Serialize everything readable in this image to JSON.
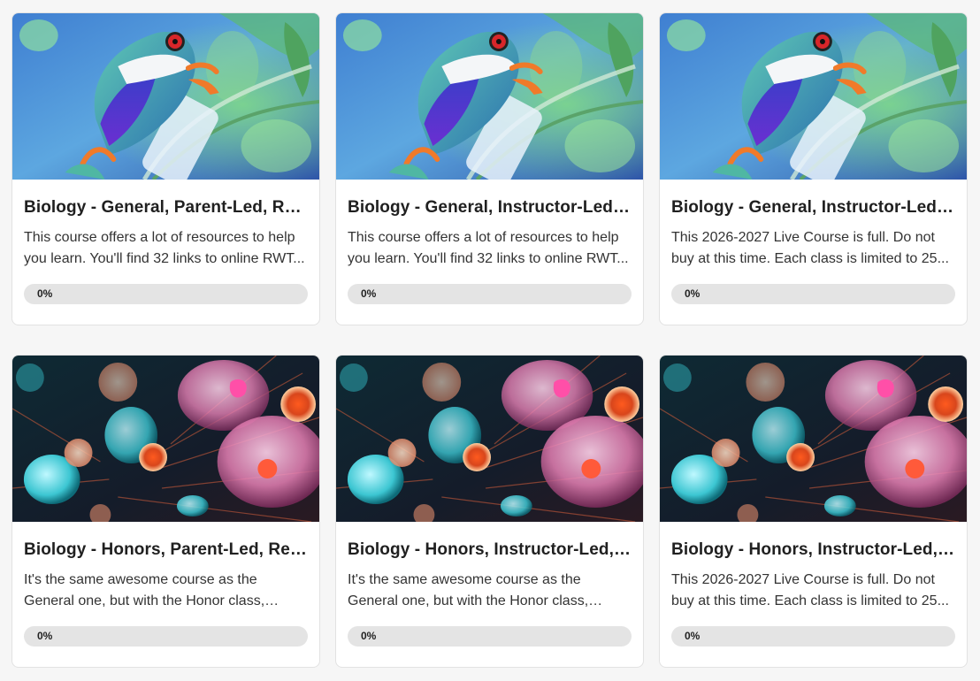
{
  "courses": [
    {
      "title": "Biology - General, Parent-Led, Re...",
      "description": "This course offers a lot of resources to help you learn. You'll find 32 links to online RWT...",
      "progress_label": "0%",
      "progress": 0,
      "image": "frog-image"
    },
    {
      "title": "Biology - General, Instructor-Led, ...",
      "description": "This course offers a lot of resources to help you learn. You'll find 32 links to online RWT...",
      "progress_label": "0%",
      "progress": 0,
      "image": "frog-image"
    },
    {
      "title": "Biology - General, Instructor-Led, ...",
      "description": "This 2026-2027 Live Course is full. Do not buy at this time. Each class is limited to 25...",
      "progress_label": "0%",
      "progress": 0,
      "image": "frog-image"
    },
    {
      "title": "Biology - Honors, Parent-Led, Rec...",
      "description": "It's the same awesome course as the General one, but with the Honor class, students nee...",
      "progress_label": "0%",
      "progress": 0,
      "image": "cells-image"
    },
    {
      "title": "Biology - Honors, Instructor-Led, ...",
      "description": "It's the same awesome course as the General one, but with the Honor class, students nee...",
      "progress_label": "0%",
      "progress": 0,
      "image": "cells-image"
    },
    {
      "title": "Biology - Honors, Instructor-Led, ...",
      "description": "This 2026-2027 Live Course is full. Do not buy at this time. Each class is limited to 25...",
      "progress_label": "0%",
      "progress": 0,
      "image": "cells-image"
    }
  ]
}
